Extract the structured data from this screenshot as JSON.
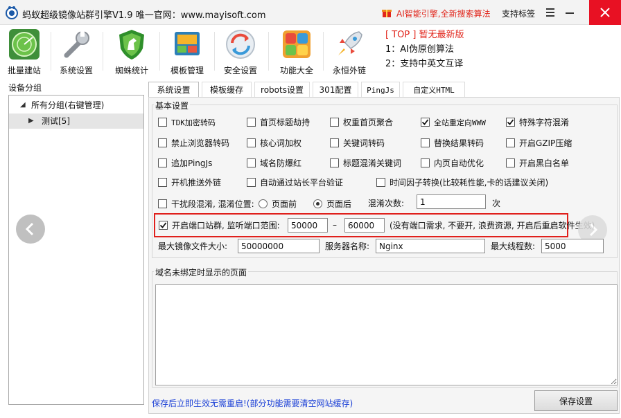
{
  "window": {
    "title": "蚂蚁超级镜像站群引擎V1.9  唯一官网：www.mayisoft.com",
    "ai_label": "AI智能引擎,全新搜索算法",
    "support_label": "支持标签"
  },
  "toolbar": {
    "items": [
      {
        "label": "批量建站",
        "icon": "radar-icon"
      },
      {
        "label": "系统设置",
        "icon": "wrench-icon"
      },
      {
        "label": "蜘蛛统计",
        "icon": "shield-horse-icon"
      },
      {
        "label": "模板管理",
        "icon": "template-folder-icon"
      },
      {
        "label": "安全设置",
        "icon": "refresh-circle-icon"
      },
      {
        "label": "功能大全",
        "icon": "app-grid-icon"
      },
      {
        "label": "永恒外链",
        "icon": "rocket-icon"
      }
    ],
    "notice": {
      "line1": "[ TOP ] 暂无最新版",
      "line2": "1：AI伪原创算法",
      "line3": "2：支持中英文互译"
    }
  },
  "sidebar": {
    "title": "设备分组",
    "root": "所有分组(右键管理)",
    "child": "测试[5]"
  },
  "tabs": [
    {
      "label": "系统设置",
      "active": true
    },
    {
      "label": "模板缓存",
      "active": false
    },
    {
      "label": "robots设置",
      "active": false
    },
    {
      "label": "301配置",
      "active": false
    },
    {
      "label": "PingJs",
      "active": false
    },
    {
      "label": "自定义HTML",
      "active": false
    }
  ],
  "basic": {
    "legend": "基本设置",
    "row1": [
      {
        "label": "TDK加密转码",
        "checked": false
      },
      {
        "label": "首页标题劫持",
        "checked": false
      },
      {
        "label": "权重首页聚合",
        "checked": false
      },
      {
        "label": "全站重定向WWW",
        "checked": true
      },
      {
        "label": "特殊字符混淆",
        "checked": true
      }
    ],
    "row2": [
      {
        "label": "禁止浏览器转码",
        "checked": false
      },
      {
        "label": "核心词加权",
        "checked": false
      },
      {
        "label": "关键词转码",
        "checked": false
      },
      {
        "label": "替换结果转码",
        "checked": false
      },
      {
        "label": "开启GZIP压缩",
        "checked": false
      }
    ],
    "row3": [
      {
        "label": "追加PingJs",
        "checked": false
      },
      {
        "label": "域名防爆红",
        "checked": false
      },
      {
        "label": "标题混淆关键词",
        "checked": false
      },
      {
        "label": "内页自动优化",
        "checked": false
      },
      {
        "label": "开启黑白名单",
        "checked": false
      }
    ],
    "row4": [
      {
        "label": "开机推送外链",
        "checked": false
      },
      {
        "label": "自动通过站长平台验证",
        "checked": false
      },
      {
        "label": "时间因子转换(比较耗性能,卡的话建议关闭)",
        "checked": false
      }
    ],
    "interference": {
      "label": "干扰段混淆, 混淆位置:",
      "option_before": "页面前",
      "option_after": "页面后",
      "count_label": "混淆次数:",
      "count_value": "1",
      "count_unit": "次"
    },
    "port": {
      "label": "开启端口站群, 监听端口范围:",
      "from": "50000",
      "dash": "–",
      "to": "60000",
      "hint": "(没有端口需求, 不要开, 浪费资源, 开启后重启软件生效)"
    },
    "max_file_label": "最大镜像文件大小:",
    "max_file_value": "50000000",
    "server_name_label": "服务器名称:",
    "server_name_value": "Nginx",
    "max_threads_label": "最大线程数:",
    "max_threads_value": "5000"
  },
  "unbound": {
    "legend": "域名未绑定时显示的页面",
    "value": ""
  },
  "footer": {
    "note": "保存后立即生效无需重启!(部分功能需要清空网站缓存)",
    "save_label": "保存设置"
  },
  "colors": {
    "accent_red": "#e0201c",
    "note_blue": "#1a3fd6",
    "close_red": "#e81123"
  }
}
